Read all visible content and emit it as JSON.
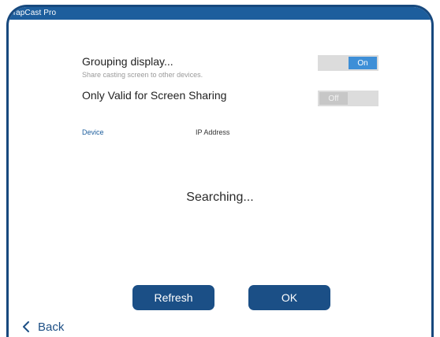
{
  "app": {
    "title": "TapCast Pro"
  },
  "grouping": {
    "title": "Grouping display...",
    "subtitle": "Share casting screen to other devices.",
    "switch_label": "On",
    "switch_state": "on"
  },
  "screen_sharing": {
    "title": "Only Valid for Screen Sharing",
    "switch_label": "Off",
    "switch_state": "off"
  },
  "device_list": {
    "headers": {
      "device": "Device",
      "ip": "IP Address"
    },
    "status": "Searching..."
  },
  "buttons": {
    "refresh": "Refresh",
    "ok": "OK"
  },
  "nav": {
    "back": "Back"
  },
  "colors": {
    "accent": "#1d5e9d",
    "button": "#1b4f86",
    "switch_on": "#3e8fd7"
  }
}
